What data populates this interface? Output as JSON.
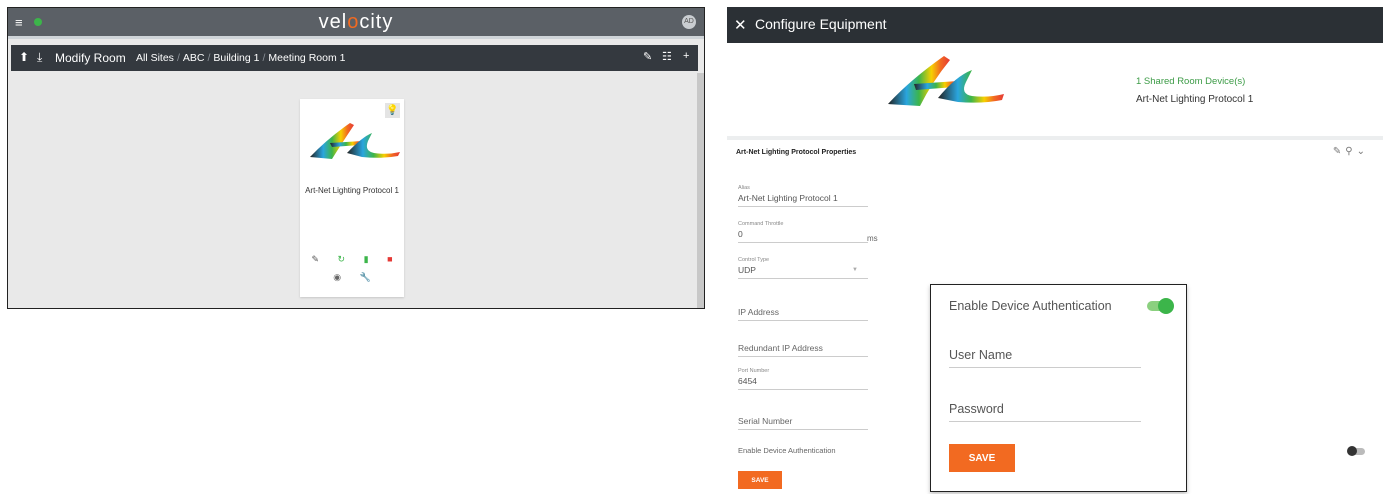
{
  "left_app": {
    "brand": "velocity",
    "menu_icon": "hamburger-icon",
    "avatar_text": "AD",
    "room_bar": {
      "title": "Modify Room",
      "breadcrumb": [
        "All Sites",
        "ABC",
        "Building 1",
        "Meeting Room 1"
      ],
      "separator": "/"
    },
    "card": {
      "name": "Art-Net Lighting Protocol 1",
      "actions_row1": [
        "edit-icon",
        "refresh-icon",
        "battery-icon",
        "delete-icon"
      ],
      "actions_row2": [
        "signal-icon",
        "wrench-icon"
      ]
    },
    "colors": {
      "accent_orange": "#f26a21",
      "status_green": "#3cb54a",
      "delete_red": "#e53935"
    }
  },
  "modal": {
    "title": "Configure Equipment",
    "shared_count": "1 Shared Room Device(s)",
    "device_name": "Art-Net Lighting Protocol 1",
    "properties_title": "Art-Net Lighting Protocol Properties",
    "fields": {
      "alias": {
        "label": "Alias",
        "value": "Art-Net Lighting Protocol 1"
      },
      "command_throttle": {
        "label": "Command Throttle",
        "value": "0",
        "unit": "ms"
      },
      "control_type": {
        "label": "Control Type",
        "value": "UDP"
      },
      "ip_address": {
        "placeholder": "IP Address"
      },
      "redundant_ip": {
        "placeholder": "Redundant IP Address"
      },
      "port_number": {
        "label": "Port Number",
        "value": "6454"
      },
      "serial_number": {
        "placeholder": "Serial Number"
      }
    },
    "enable_auth_label": "Enable Device Authentication",
    "save_label": "SAVE"
  },
  "zoom": {
    "enable_auth_label": "Enable Device Authentication",
    "user_name_placeholder": "User Name",
    "password_placeholder": "Password",
    "save_label": "SAVE"
  }
}
